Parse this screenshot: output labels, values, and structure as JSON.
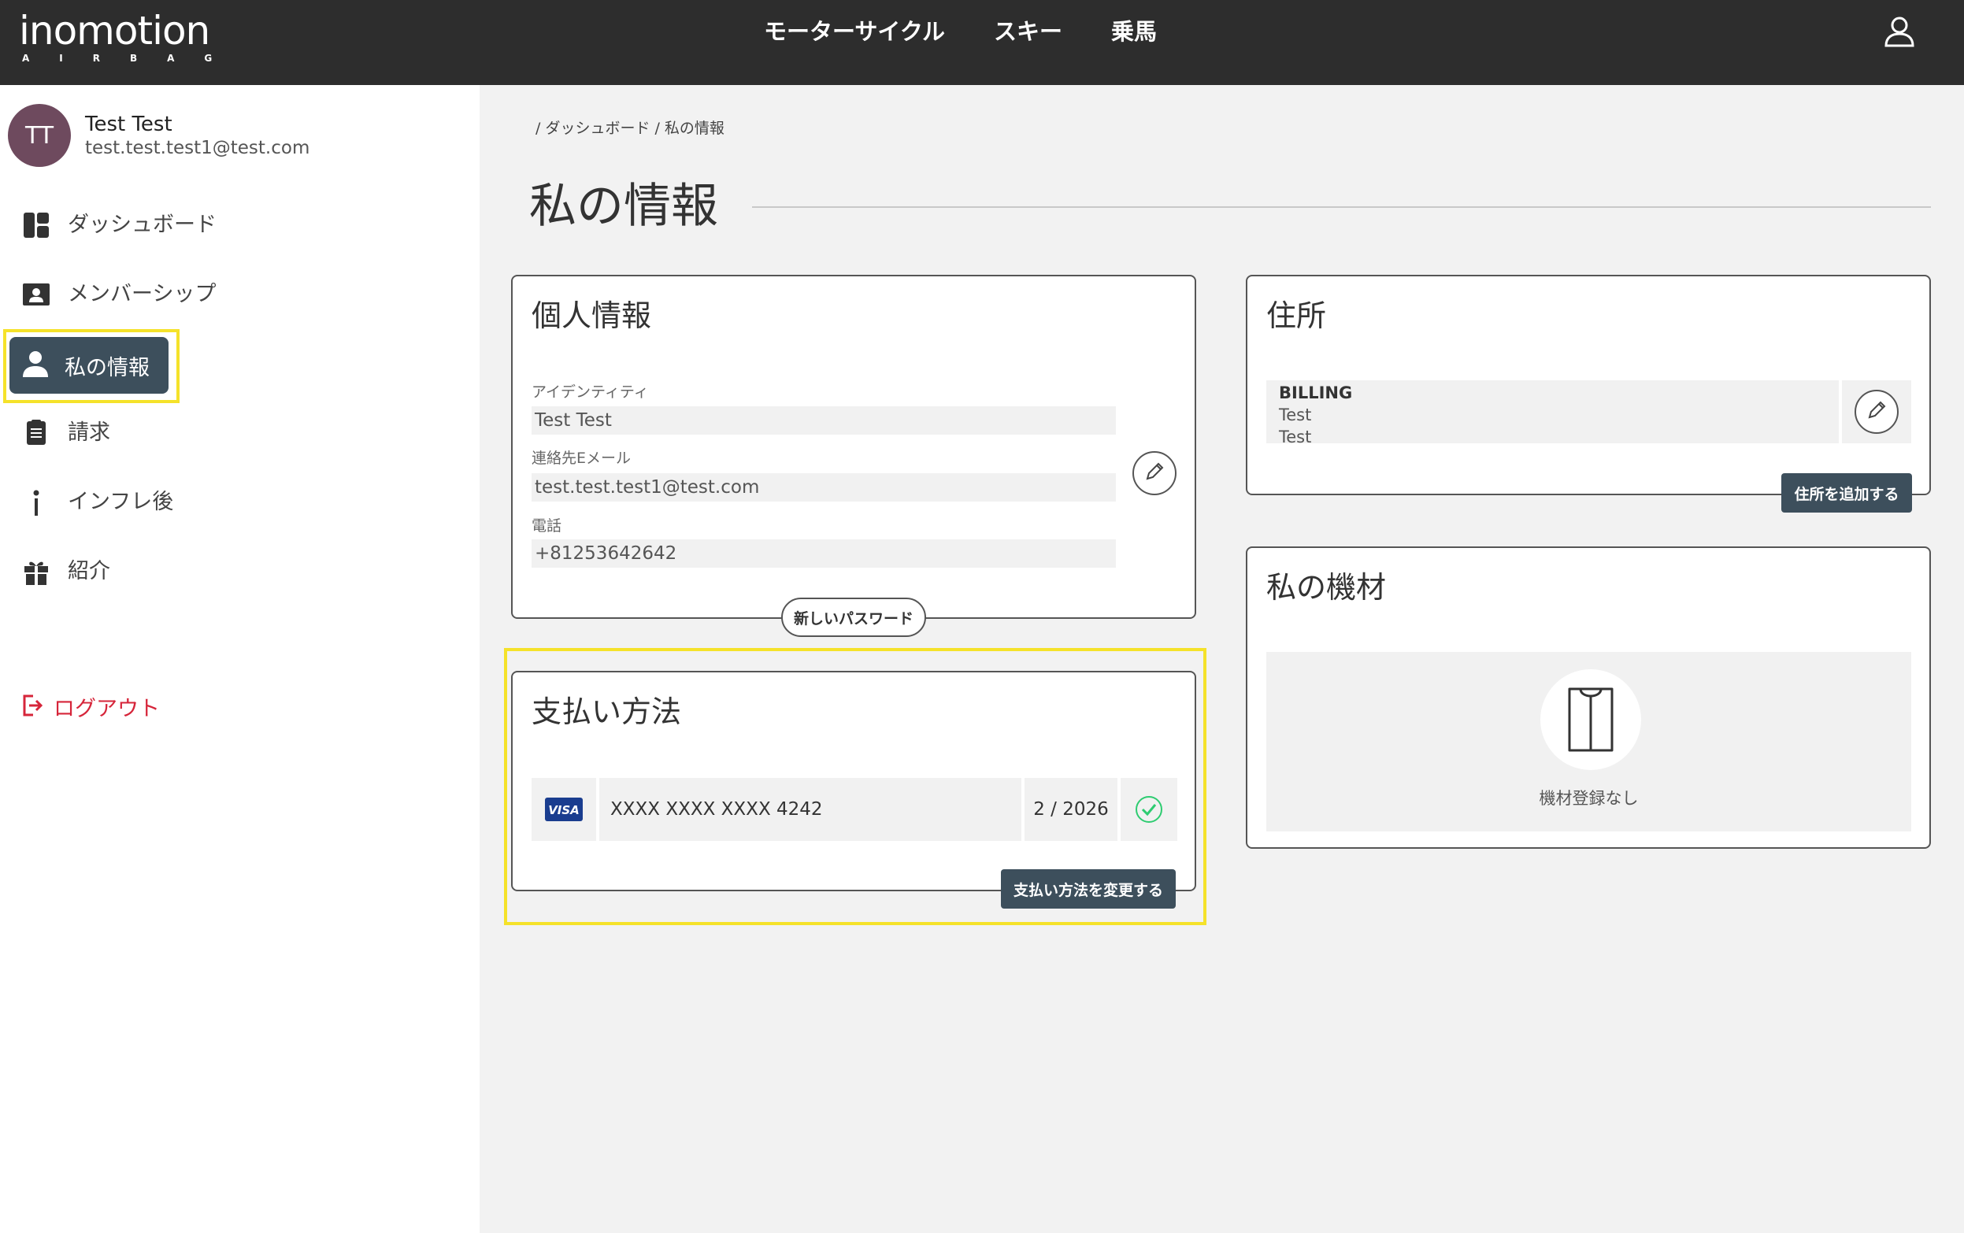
{
  "header": {
    "logo_main": "inomotion",
    "logo_sub": "AIRBAG",
    "nav": [
      "モーターサイクル",
      "スキー",
      "乗馬"
    ]
  },
  "profile": {
    "initials": "TT",
    "name": "Test Test",
    "email": "test.test.test1@test.com"
  },
  "sidebar": {
    "items": [
      {
        "label": "ダッシュボード",
        "icon": "dashboard-icon"
      },
      {
        "label": "メンバーシップ",
        "icon": "id-card-icon"
      },
      {
        "label": "私の情報",
        "icon": "person-icon",
        "active": true
      },
      {
        "label": "請求",
        "icon": "receipt-icon"
      },
      {
        "label": "インフレ後",
        "icon": "info-icon"
      },
      {
        "label": "紹介",
        "icon": "gift-icon"
      }
    ],
    "logout": "ログアウト"
  },
  "breadcrumb": "/ ダッシュボード / 私の情報",
  "page_title": "私の情報",
  "personal": {
    "title": "個人情報",
    "identity_label": "アイデンティティ",
    "identity_value": "Test Test",
    "email_label": "連絡先Eメール",
    "email_value": "test.test.test1@test.com",
    "phone_label": "電話",
    "phone_value": "+81253642642",
    "new_password_button": "新しいパスワード"
  },
  "payment": {
    "title": "支払い方法",
    "card_brand": "VISA",
    "card_number": "XXXX XXXX XXXX 4242",
    "expiry": "2 / 2026",
    "change_button": "支払い方法を変更する"
  },
  "address": {
    "title": "住所",
    "billing_title": "BILLING",
    "line1": "Test",
    "line2": "Test",
    "add_button": "住所を追加する"
  },
  "equipment": {
    "title": "私の機材",
    "empty_text": "機材登録なし"
  },
  "colors": {
    "topbar": "#2d2d2d",
    "active": "#3d4f5c",
    "highlight": "#f5e22a",
    "logout": "#d6253a",
    "avatar": "#6e4a5e",
    "check": "#2ecc71",
    "visa": "#1a3d8f"
  }
}
